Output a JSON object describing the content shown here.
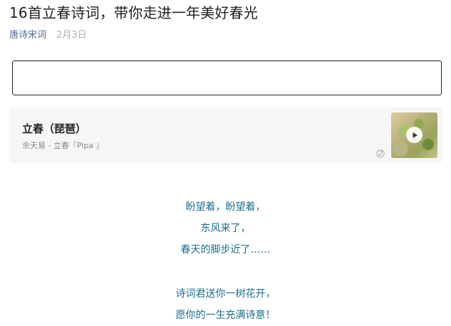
{
  "article": {
    "title": "16首立春诗词，带你走进一年美好春光",
    "account": "唐诗宋词",
    "date": "2月3日"
  },
  "music": {
    "title": "立春（琵琶）",
    "subtitle": "佘天易 - 立春『Pipa 』",
    "cover_icon": "play-icon",
    "badge_icon": "music-note-icon"
  },
  "poem": {
    "stanza1": [
      "盼望着，盼望着，",
      "东风来了，",
      "春天的脚步近了……"
    ],
    "stanza2": [
      "诗词君送你一树花开，",
      "愿你的一生充满诗意！"
    ]
  },
  "colors": {
    "title": "#222222",
    "account_link": "#576b95",
    "date": "#b2b2b2",
    "card_bg": "#f6f6f6",
    "poem_text": "#1a6e8e"
  }
}
